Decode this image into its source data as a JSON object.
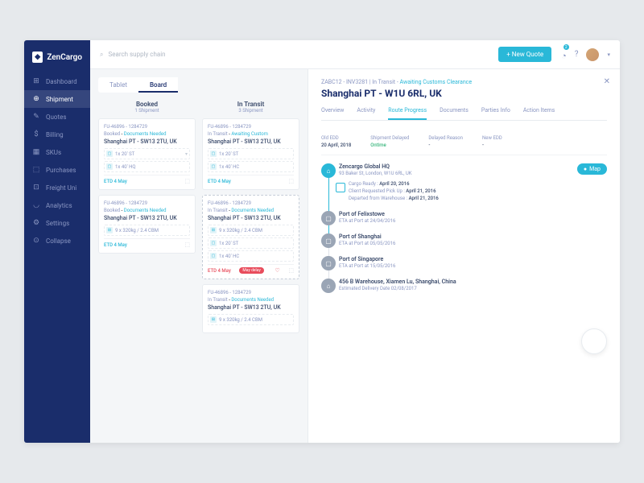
{
  "brand": "ZenCargo",
  "search_placeholder": "Search supply chain",
  "new_quote": "+  New Quote",
  "notif_count": "2",
  "nav": [
    {
      "icon": "⊞",
      "label": "Dashboard"
    },
    {
      "icon": "⊕",
      "label": "Shipment"
    },
    {
      "icon": "✎",
      "label": "Quotes"
    },
    {
      "icon": "$",
      "label": "Billing"
    },
    {
      "icon": "▦",
      "label": "SKUs"
    },
    {
      "icon": "⬚",
      "label": "Purchases"
    },
    {
      "icon": "⊡",
      "label": "Freight Uni"
    },
    {
      "icon": "◡",
      "label": "Analytics"
    },
    {
      "icon": "⚙",
      "label": "Settings"
    },
    {
      "icon": "⊙",
      "label": "Collapse"
    }
  ],
  "board_tabs": {
    "tablet": "Tablet",
    "board": "Board"
  },
  "columns": {
    "booked": {
      "title": "Booked",
      "sub": "1 Shipment"
    },
    "transit": {
      "title": "In Transit",
      "sub": "3 Shipment"
    }
  },
  "cards": {
    "b1": {
      "id": "FU-46896 - 1284729",
      "s1": "Booked",
      "s2": "Documents Needed",
      "title": "Shanghai PT - SW13 2TU, UK",
      "i1": "1x 20' ST",
      "i2": "1x 40' HQ",
      "etd": "ETD 4 May"
    },
    "b2": {
      "id": "FU-46896 - 1284729",
      "s1": "Booked",
      "s2": "Documents Needed",
      "title": "Shanghai PT - SW13 2TU, UK",
      "i1": "9 x 320kg / 2.4 CBM",
      "etd": "ETD 4 May"
    },
    "t1": {
      "id": "FU-46896 - 1284729",
      "s1": "In Transit",
      "s2": "Awaiting Custom",
      "title": "Shanghai PT - SW13 2TU, UK",
      "i1": "1x 20' ST",
      "i2": "1x 40' HC",
      "etd": "ETD 4 May"
    },
    "t2": {
      "id": "FU-46896 - 1284729",
      "s1": "In Transit",
      "s2": "Documents Needed",
      "title": "Shanghai PT - SW13 2TU, UK",
      "i1": "9 x 320kg / 2.4 CBM",
      "i2": "1x 20' ST",
      "i3": "1x 40' HC",
      "etd": "ETD 4 May",
      "pill": "May delay"
    },
    "t3": {
      "id": "FU-46896 - 1284729",
      "s1": "In Transit",
      "s2": "Documents Needed",
      "title": "Shanghai PT - SW13 2TU, UK",
      "i1": "9 x 320kg / 2.4 CBM"
    }
  },
  "detail": {
    "breadcrumb": {
      "a": "ZABC12 - INV3281",
      "b": "In Transit",
      "c": "Awaiting Customs Clearance"
    },
    "title": "Shanghai PT - W1U 6RL, UK",
    "tabs": [
      "Overview",
      "Activity",
      "Route Progress",
      "Documents",
      "Parties Info",
      "Action Items"
    ],
    "info": {
      "old_edd_l": "Old EDD",
      "old_edd_v": "20 April, 2018",
      "delay_l": "Shipment Delayed",
      "delay_v": "Ontime",
      "reason_l": "Delayed Reason",
      "reason_v": "-",
      "new_l": "New EDD",
      "new_v": "-"
    },
    "map_btn": "Map",
    "timeline": {
      "hq": {
        "title": "Zencargo Global HQ",
        "sub": "93 Baker St, London, W1U 6RL, UK",
        "d1": "Cargo Ready : ",
        "d1v": "April 20, 2016",
        "d2": "Client Requested Pick Up : ",
        "d2v": "April 21, 2016",
        "d3": "Departed from Warehouse : ",
        "d3v": "April 21, 2016"
      },
      "felix": {
        "title": "Port of Felixstowe",
        "sub": "ETA at Port at 24/04/2016"
      },
      "shang": {
        "title": "Port of Shanghai",
        "sub": "ETA at Port at 05/05/2016"
      },
      "sing": {
        "title": "Port of Singapore",
        "sub": "ETA at Port at 15/05/2016"
      },
      "wh": {
        "title": "456 B Warehouse, Xiamen Lu, Shanghai, China",
        "sub": "Estimated Delivery Date 02/08/2017"
      }
    }
  }
}
